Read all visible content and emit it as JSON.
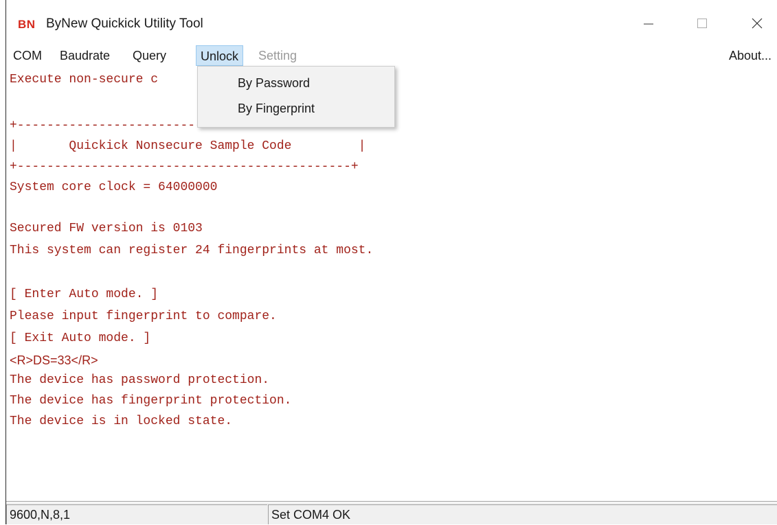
{
  "window": {
    "logo": "BN",
    "title": "ByNew Quickick Utility Tool"
  },
  "menubar": {
    "items": [
      "COM",
      "Baudrate",
      "Query",
      "Unlock",
      "Setting"
    ],
    "about": "About..."
  },
  "dropdown": {
    "items": [
      "By Password",
      "By Fingerprint"
    ]
  },
  "console": {
    "lines": [
      "Execute non-secure c",
      "",
      "+---------------------------------------------+",
      "|       Quickick Nonsecure Sample Code         |",
      "+---------------------------------------------+",
      "System core clock = 64000000",
      "",
      "Secured FW version is 0103",
      "This system can register 24 fingerprints at most.",
      "",
      "[ Enter Auto mode. ]",
      "Please input fingerprint to compare.",
      "[ Exit Auto mode. ]",
      "",
      "<R>DS=33</R>",
      "The device has password protection.",
      "The device has fingerprint protection.",
      "The device is in locked state."
    ]
  },
  "statusbar": {
    "port_settings": "9600,N,8,1",
    "message": "Set COM4 OK"
  },
  "colors": {
    "console_text": "#a1221a",
    "logo": "#d62a1e",
    "menu_highlight": "#cce4f7"
  }
}
